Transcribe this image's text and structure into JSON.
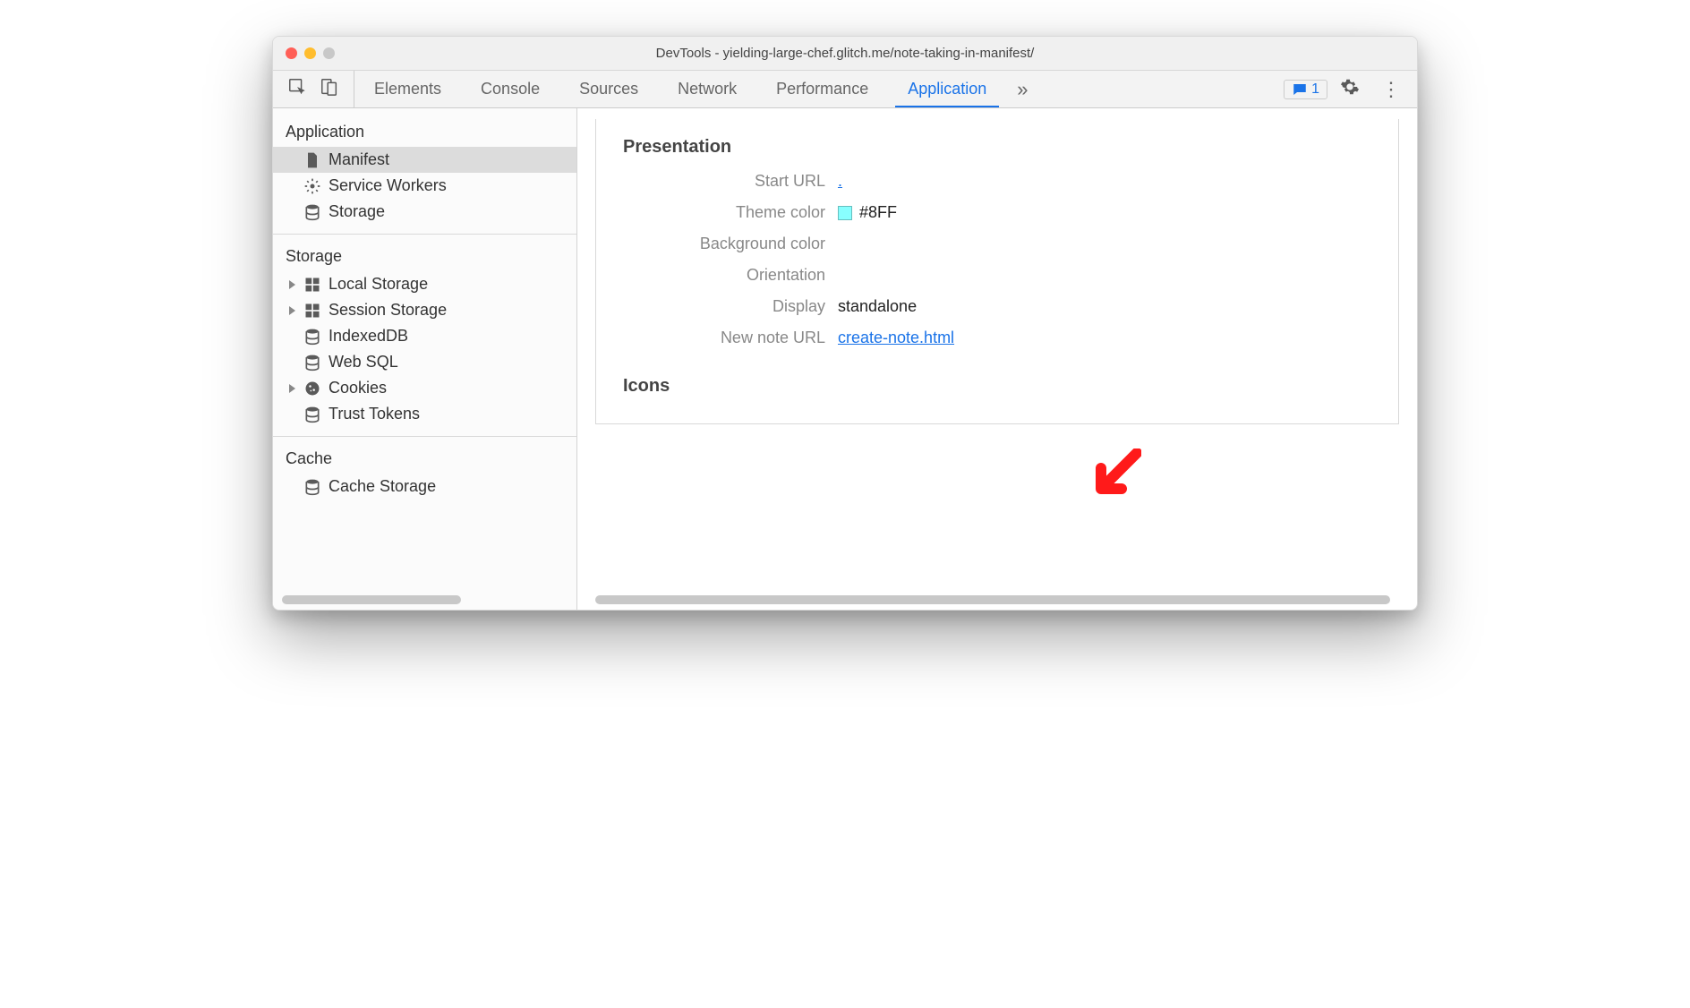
{
  "window_title": "DevTools - yielding-large-chef.glitch.me/note-taking-in-manifest/",
  "tabs": [
    "Elements",
    "Console",
    "Sources",
    "Network",
    "Performance",
    "Application"
  ],
  "active_tab_index": 5,
  "errors_count": "1",
  "sidebar": {
    "groups": [
      {
        "title": "Application",
        "items": [
          {
            "label": "Manifest",
            "selected": true,
            "icon": "file",
            "arrow": false
          },
          {
            "label": "Service Workers",
            "icon": "gear",
            "arrow": false
          },
          {
            "label": "Storage",
            "icon": "db",
            "arrow": false
          }
        ]
      },
      {
        "title": "Storage",
        "items": [
          {
            "label": "Local Storage",
            "icon": "grid",
            "arrow": true
          },
          {
            "label": "Session Storage",
            "icon": "grid",
            "arrow": true
          },
          {
            "label": "IndexedDB",
            "icon": "db",
            "arrow": false
          },
          {
            "label": "Web SQL",
            "icon": "db",
            "arrow": false
          },
          {
            "label": "Cookies",
            "icon": "cookie",
            "arrow": true
          },
          {
            "label": "Trust Tokens",
            "icon": "db",
            "arrow": false
          }
        ]
      },
      {
        "title": "Cache",
        "items": [
          {
            "label": "Cache Storage",
            "icon": "db",
            "arrow": false
          }
        ]
      }
    ]
  },
  "content": {
    "section": "Presentation",
    "rows": {
      "start_url_label": "Start URL",
      "start_url_value": ".",
      "theme_color_label": "Theme color",
      "theme_color_value": "#8FF",
      "bg_color_label": "Background color",
      "bg_color_value": "",
      "orientation_label": "Orientation",
      "orientation_value": "",
      "display_label": "Display",
      "display_value": "standalone",
      "new_note_label": "New note URL",
      "new_note_value": "create-note.html"
    },
    "icons_section": "Icons"
  },
  "colors": {
    "theme_swatch": "#88FFFF"
  }
}
